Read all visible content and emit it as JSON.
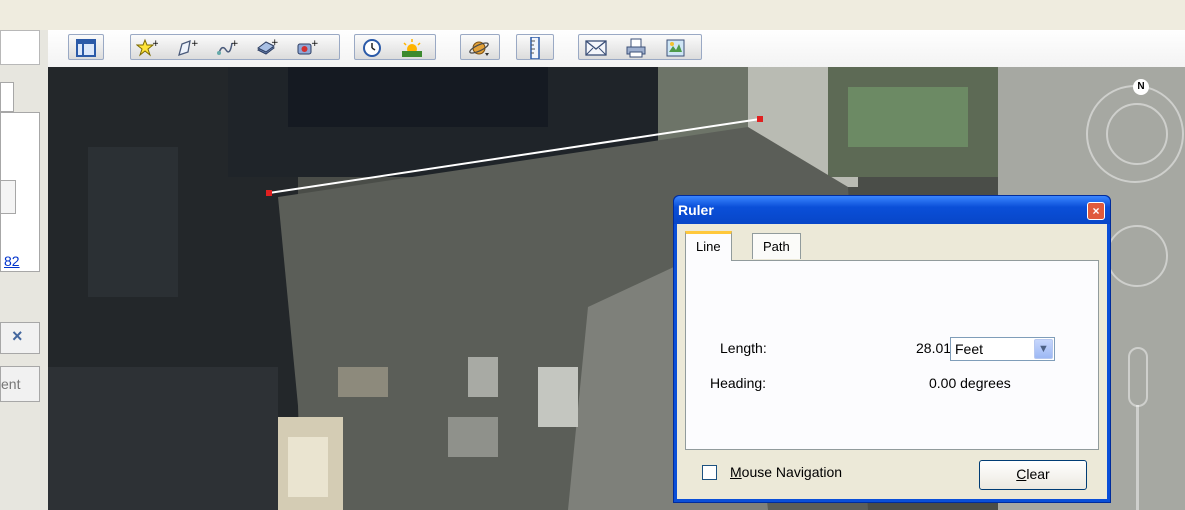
{
  "toolbar": {
    "icons": [
      "sidebar-toggle-icon",
      "add-placemark-icon",
      "add-polygon-icon",
      "add-path-icon",
      "add-image-overlay-icon",
      "record-tour-icon",
      "historical-imagery-icon",
      "sunlight-icon",
      "switch-planet-icon",
      "ruler-icon",
      "email-icon",
      "print-icon",
      "view-in-maps-icon"
    ]
  },
  "left_panel": {
    "link_text": "82",
    "close_glyph": "×",
    "partial_text": "ent"
  },
  "navigation": {
    "north_label": "N"
  },
  "ruler": {
    "title": "Ruler",
    "close_glyph": "×",
    "tabs": [
      "Line",
      "Path"
    ],
    "active_tab": "Line",
    "length_label": "Length:",
    "length_value": "28.01",
    "unit_selected": "Feet",
    "heading_label": "Heading:",
    "heading_value": "0.00 degrees",
    "mouse_nav_label_mnemonic": "M",
    "mouse_nav_label_rest": "ouse Navigation",
    "mouse_nav_checked": false,
    "clear_mnemonic": "C",
    "clear_rest": "lear"
  },
  "colors": {
    "title_bar": "#0a4fd8",
    "active_tab_accent": "#ffc83c",
    "measure_line": "#ffffff",
    "measure_endpoint": "#e02020"
  }
}
